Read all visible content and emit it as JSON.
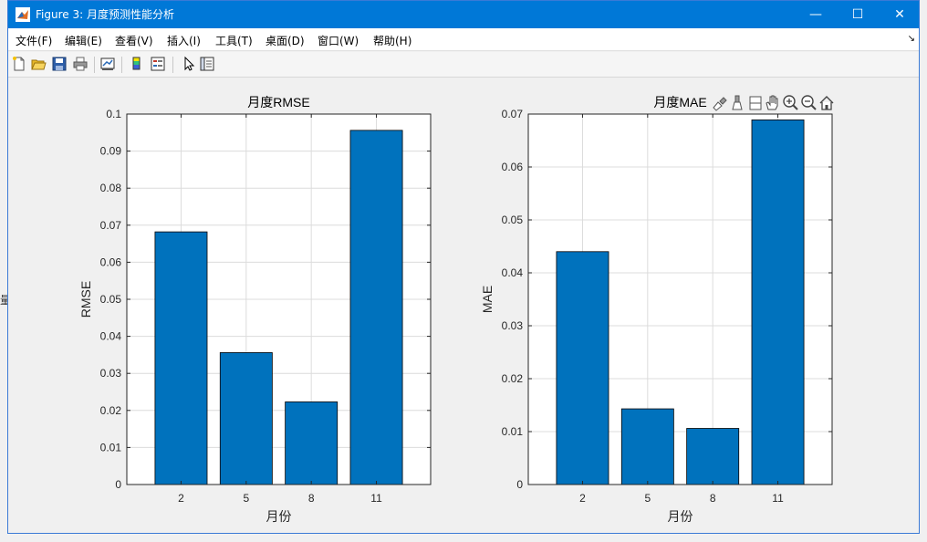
{
  "window": {
    "title": "Figure 3: 月度预测性能分析",
    "controls": {
      "minimize": "—",
      "maximize": "☐",
      "close": "✕"
    }
  },
  "menu": {
    "items": [
      "文件(F)",
      "编辑(E)",
      "查看(V)",
      "插入(I)",
      "工具(T)",
      "桌面(D)",
      "窗口(W)",
      "帮助(H)"
    ]
  },
  "toolbar": {
    "buttons": [
      "new-figure-icon",
      "open-file-icon",
      "save-icon",
      "print-icon",
      "link-plot-icon",
      "colorbar-icon",
      "legend-icon",
      "edit-plot-arrow-icon",
      "property-editor-icon"
    ]
  },
  "axes_toolbar": {
    "buttons": [
      "brush-icon",
      "data-tip-icon",
      "restore-view-icon",
      "pan-icon",
      "zoom-in-icon",
      "zoom-out-icon",
      "home-icon"
    ]
  },
  "background_fragments": {
    "left_char": "量"
  },
  "colors": {
    "bar": "#0072bd",
    "titlebar": "#0078d7"
  },
  "chart_data": [
    {
      "type": "bar",
      "title": "月度RMSE",
      "xlabel": "月份",
      "ylabel": "RMSE",
      "categories": [
        "2",
        "5",
        "8",
        "11"
      ],
      "values": [
        0.0682,
        0.0356,
        0.0223,
        0.0956
      ],
      "ylim": [
        0,
        0.1
      ],
      "yticks": [
        "0",
        "0.01",
        "0.02",
        "0.03",
        "0.04",
        "0.05",
        "0.06",
        "0.07",
        "0.08",
        "0.09",
        "0.1"
      ],
      "grid": true
    },
    {
      "type": "bar",
      "title": "月度MAE",
      "xlabel": "月份",
      "ylabel": "MAE",
      "categories": [
        "2",
        "5",
        "8",
        "11"
      ],
      "values": [
        0.044,
        0.0143,
        0.0106,
        0.0689
      ],
      "ylim": [
        0,
        0.07
      ],
      "yticks": [
        "0",
        "0.01",
        "0.02",
        "0.03",
        "0.04",
        "0.05",
        "0.06",
        "0.07"
      ],
      "grid": true
    }
  ]
}
